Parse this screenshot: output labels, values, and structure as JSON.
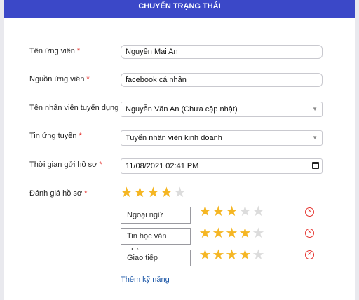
{
  "modal": {
    "title": "CHUYỂN TRẠNG THÁI"
  },
  "form": {
    "candidate_name": {
      "label": "Tên ứng viên",
      "required": "*",
      "value": "Nguyễn Mai An"
    },
    "candidate_source": {
      "label": "Nguồn ứng viên",
      "required": "*",
      "value": "facebook cá nhân"
    },
    "recruiter": {
      "label": "Tên nhân viên tuyển dụng",
      "required": "*",
      "value": "Nguyễn Văn An (Chưa cập nhật)"
    },
    "job_posting": {
      "label": "Tin ứng tuyển",
      "required": "*",
      "value": "Tuyển nhân viên kinh doanh"
    },
    "submit_time": {
      "label": "Thời gian gửi hồ sơ",
      "required": "*",
      "value": "11/08/2021 02:41 PM"
    },
    "rating": {
      "label": "Đánh giá hồ sơ",
      "required": "*",
      "value": 4,
      "max": 5
    }
  },
  "skills": [
    {
      "name": "Ngoại ngữ",
      "rating": 3,
      "max": 5
    },
    {
      "name": "Tin học văn phòng",
      "rating": 4,
      "max": 5
    },
    {
      "name": "Giao tiếp",
      "rating": 4,
      "max": 5
    }
  ],
  "add_skill_label": "Thêm kỹ năng",
  "colors": {
    "header": "#3b48c8",
    "star_on": "#f5b623",
    "star_off": "#dcdcdc",
    "required": "#e5322d",
    "link": "#1f59a8"
  }
}
